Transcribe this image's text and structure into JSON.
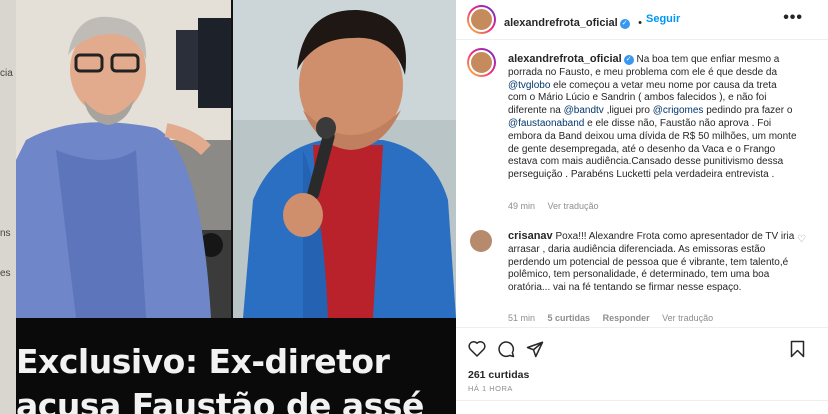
{
  "media": {
    "side_fragments": [
      "cia",
      "ns",
      "es"
    ],
    "headline_line1": "Exclusivo: Ex-diretor",
    "headline_line2": "acusa Faustão de assé"
  },
  "header": {
    "username": "alexandrefrota_oficial",
    "follow_label": "Seguir",
    "more_label": "•••"
  },
  "caption": {
    "username": "alexandrefrota_oficial",
    "text_1": "Na boa tem que enfiar mesmo a porrada no Fausto, e meu problema com ele é que desde da ",
    "mention_1": "@tvglobo",
    "text_2": " ele começou a vetar meu nome por causa da treta com o Mário Lúcio e Sandrin ( ambos falecidos ), e não foi diferente na ",
    "mention_2": "@bandtv",
    "text_3": " ,liguei pro ",
    "mention_3": "@crigomes",
    "text_4": " pedindo pra fazer o ",
    "mention_4": "@faustaonaband",
    "text_5": " e ele disse não, Faustão não aprova . Foi embora da Band deixou uma dívida de R$ 50 milhões, um monte de gente desempregada, até o desenho da Vaca e o Frango estava com mais audiência.Cansado desse punitivismo dessa perseguição . Parabéns Lucketti pela verdadeira entrevista .",
    "time": "49 min",
    "translate": "Ver tradução"
  },
  "comment": {
    "username": "crisanav",
    "text": "Poxa!!! Alexandre Frota como apresentador de TV iria arrasar , daria audiência diferenciada. As emissoras estão perdendo um potencial de pessoa que é vibrante, tem talento,é polêmico, tem personalidade, é determinado, tem uma boa oratória... vai na fé tentando se firmar nesse espaço.",
    "time": "51 min",
    "likes": "5 curtidas",
    "reply": "Responder",
    "translate": "Ver tradução"
  },
  "footer": {
    "likes": "261 curtidas",
    "ago": "HÁ 1 HORA"
  },
  "colors": {
    "link_blue": "#0095f6",
    "mention": "#00376b",
    "muted": "#8e8e8e",
    "verified": "#3897f0"
  }
}
